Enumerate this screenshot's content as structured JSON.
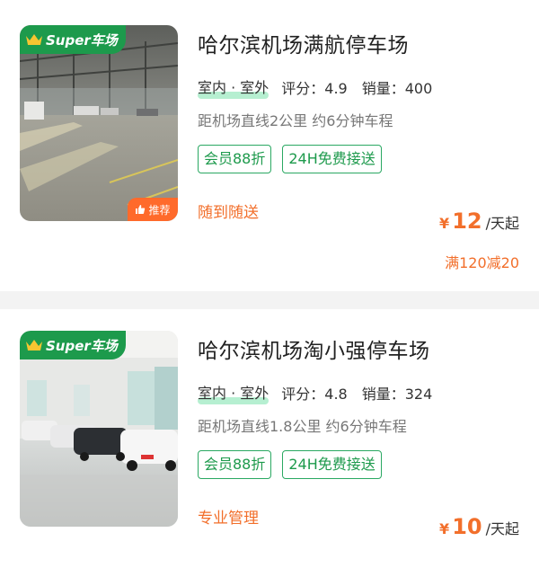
{
  "listings": [
    {
      "badge": "Super车场",
      "recommend_label": "推荐",
      "title": "哈尔滨机场满航停车场",
      "location_type": "室内 · 室外",
      "rating_label": "评分：",
      "rating": "4.9",
      "sales_label": "销量：",
      "sales": "400",
      "distance": "距机场直线2公里 约6分钟车程",
      "chips": [
        "会员88折",
        "24H免费接送"
      ],
      "service": "随到随送",
      "currency": "¥",
      "price": "12",
      "price_unit": "/天起",
      "promo": "满120减20"
    },
    {
      "badge": "Super车场",
      "title": "哈尔滨机场淘小强停车场",
      "location_type": "室内 · 室外",
      "rating_label": "评分：",
      "rating": "4.8",
      "sales_label": "销量：",
      "sales": "324",
      "distance": "距机场直线1.8公里 约6分钟车程",
      "chips": [
        "会员88折",
        "24H免费接送"
      ],
      "service": "专业管理",
      "currency": "¥",
      "price": "10",
      "price_unit": "/天起"
    }
  ],
  "colors": {
    "brand_green": "#1d9a4c",
    "accent_orange": "#f26f2b"
  }
}
